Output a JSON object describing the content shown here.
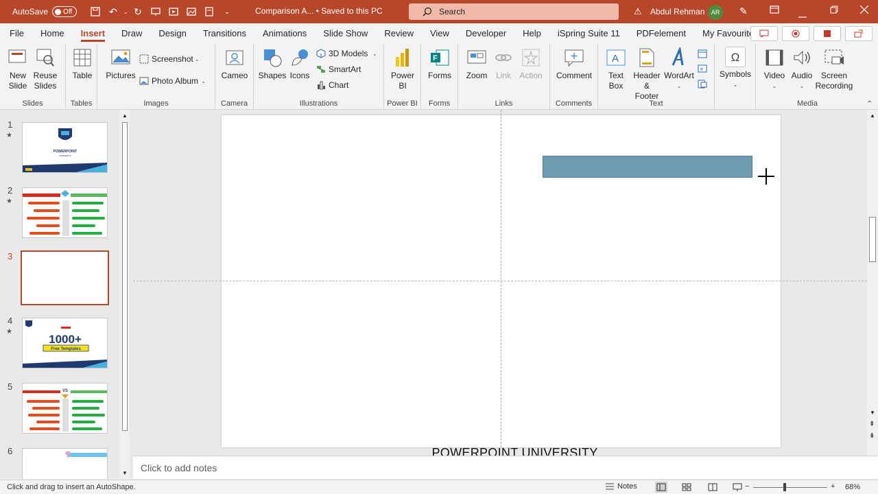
{
  "titlebar": {
    "autosave_label": "AutoSave",
    "autosave_state": "Off",
    "doc_title": "Comparison A...  •  Saved to this PC",
    "search_placeholder": "Search",
    "user_name": "Abdul Rehman",
    "user_initials": "AR"
  },
  "tabs": [
    "File",
    "Home",
    "Insert",
    "Draw",
    "Design",
    "Transitions",
    "Animations",
    "Slide Show",
    "Review",
    "View",
    "Developer",
    "Help",
    "iSpring Suite 11",
    "PDFelement",
    "My Favourites"
  ],
  "active_tab": "Insert",
  "ribbon": {
    "slides": {
      "label": "Slides",
      "new_slide": "New Slide",
      "reuse_slides": "Reuse Slides"
    },
    "tables": {
      "label": "Tables",
      "table": "Table"
    },
    "images": {
      "label": "Images",
      "pictures": "Pictures",
      "screenshot": "Screenshot",
      "photo_album": "Photo Album"
    },
    "camera": {
      "label": "Camera",
      "cameo": "Cameo"
    },
    "illustrations": {
      "label": "Illustrations",
      "shapes": "Shapes",
      "icons": "Icons",
      "models": "3D Models",
      "smartart": "SmartArt",
      "chart": "Chart"
    },
    "powerbi": {
      "label": "Power BI",
      "power_bi": "Power BI"
    },
    "forms": {
      "label": "Forms",
      "forms": "Forms"
    },
    "links": {
      "label": "Links",
      "zoom": "Zoom",
      "link": "Link",
      "action": "Action"
    },
    "comments": {
      "label": "Comments",
      "comment": "Comment"
    },
    "text": {
      "label": "Text",
      "text_box": "Text Box",
      "header_footer": "Header & Footer",
      "wordart": "WordArt"
    },
    "symbols": {
      "label": "",
      "symbols": "Symbols"
    },
    "media": {
      "label": "Media",
      "video": "Video",
      "audio": "Audio",
      "screen_recording": "Screen Recording"
    }
  },
  "thumbnails": [
    {
      "num": "1",
      "star": "★"
    },
    {
      "num": "2",
      "star": "★"
    },
    {
      "num": "3",
      "star": ""
    },
    {
      "num": "4",
      "star": "★"
    },
    {
      "num": "5",
      "star": ""
    },
    {
      "num": "6",
      "star": ""
    }
  ],
  "thumb_text": {
    "t1a": "POWERPOINT",
    "t1b": "UNIVERSITY",
    "t4a": "1000+",
    "t4b": "Free Templates",
    "t5a": "VS"
  },
  "selected_slide": 3,
  "slide": {
    "footer": "POWERPOINT UNIVERSITY",
    "shape_color": "#6f9cb1"
  },
  "notes_placeholder": "Click to add notes",
  "status": {
    "message": "Click and drag to insert an AutoShape.",
    "notes": "Notes",
    "zoom": "68%"
  },
  "colors": {
    "accent": "#b7472a"
  }
}
